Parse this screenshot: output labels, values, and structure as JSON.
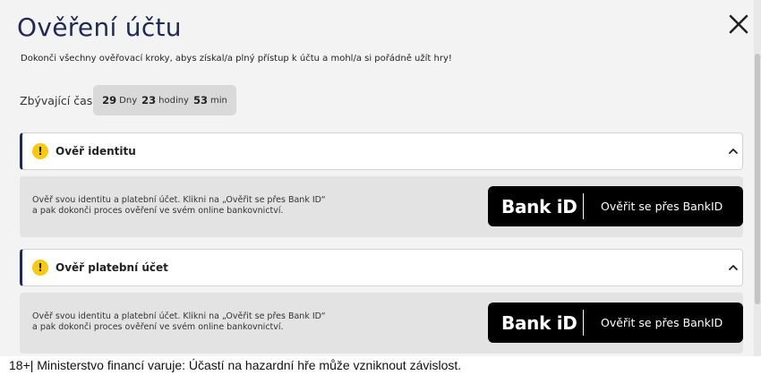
{
  "modal": {
    "title": "Ověření účtu",
    "intro": "Dokonči všechny ověřovací kroky, abys získal/a plný přístup k účtu a mohl/a si pořádně užít hry!",
    "timer": {
      "label": "Zbývající čas:",
      "days": "29",
      "days_unit": "Dny",
      "hours": "23",
      "hours_unit": "hodiny",
      "minutes": "53",
      "minutes_unit": "min"
    },
    "sections": [
      {
        "title": "Ověř identitu",
        "description_line1": "Ověř svou identitu a platební účet. Klikni na „Ověřit se přes Bank ID“",
        "description_line2": "a pak dokonči proces ověření ve svém online bankovnictví.",
        "bank_logo": "Bank iD",
        "button_label": "Ověřit se přes BankID"
      },
      {
        "title": "Ověř platební účet",
        "description_line1": "Ověř svou identitu a platební účet. Klikni na „Ověřit se přes Bank ID“",
        "description_line2": "a pak dokonči proces ověření ve svém online bankovnictví.",
        "bank_logo": "Bank iD",
        "button_label": "Ověřit se přes BankID"
      }
    ]
  },
  "footer": {
    "disclaimer": "18+| Ministerstvo financí varuje: Účastí na hazardní hře může vzniknout závislost."
  },
  "colors": {
    "title": "#1e2a55",
    "warning": "#f6c917",
    "button_bg": "#000000"
  },
  "icons": {
    "close": "close-icon",
    "warning": "warning-icon",
    "chevron": "chevron-up-icon"
  }
}
